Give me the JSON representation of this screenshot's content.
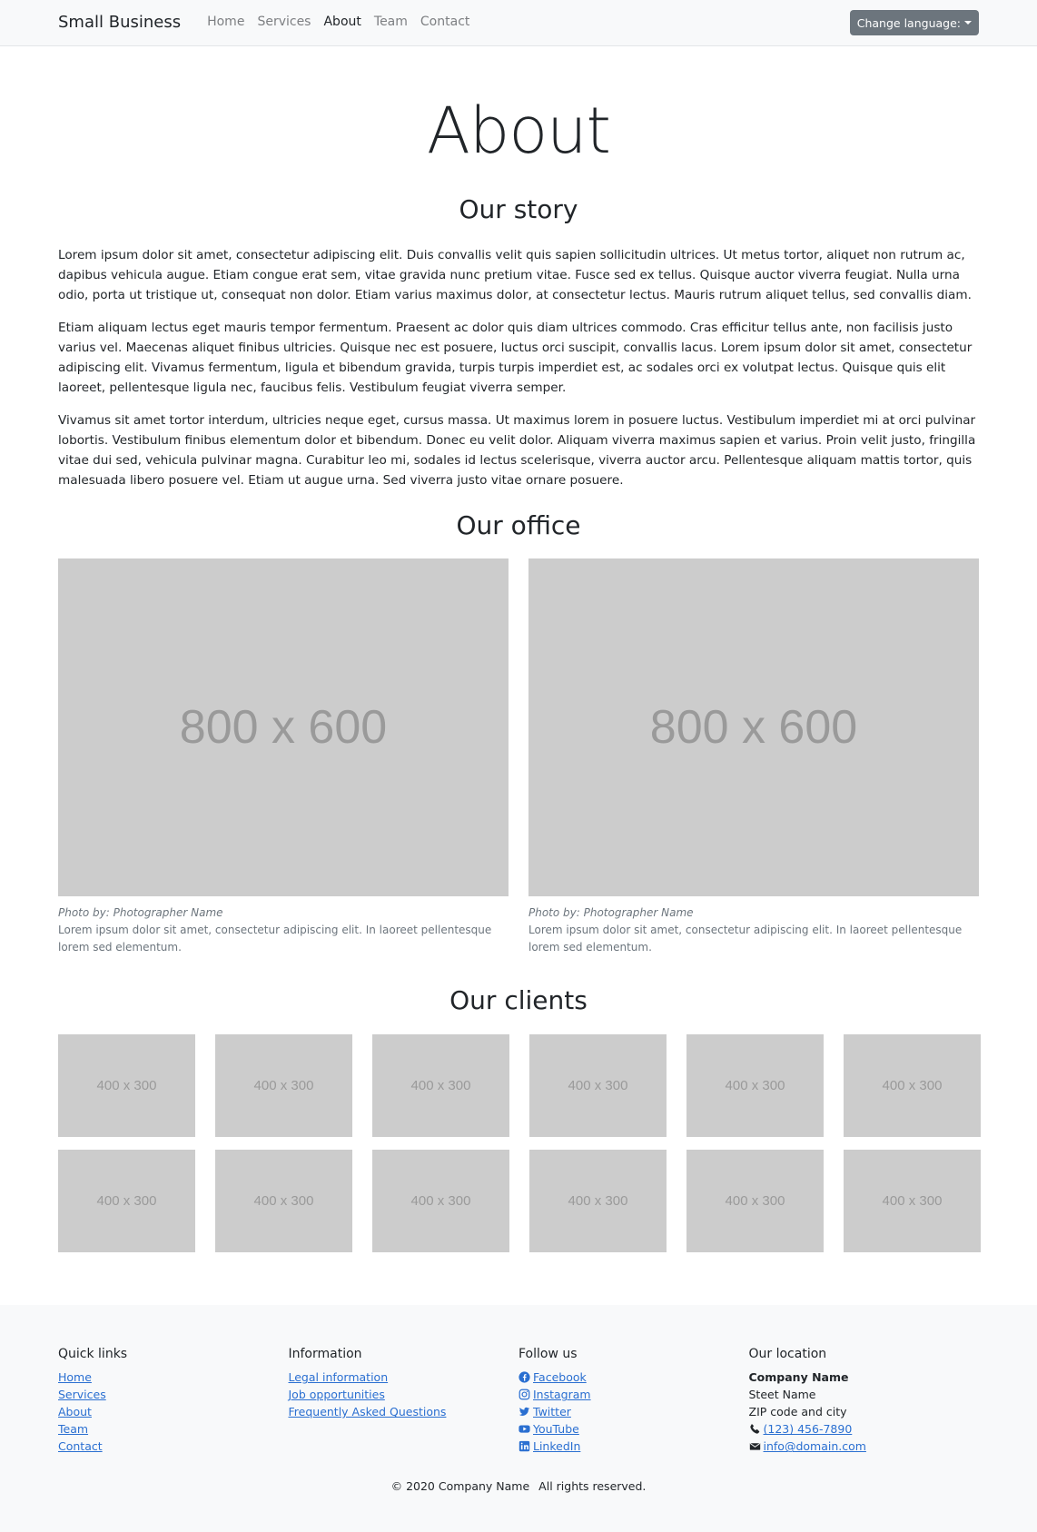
{
  "navbar": {
    "brand": "Small Business",
    "links": [
      "Home",
      "Services",
      "About",
      "Team",
      "Contact"
    ],
    "active": "About",
    "language_button": "Change language:"
  },
  "main": {
    "title": "About",
    "story": {
      "heading": "Our story",
      "paragraphs": [
        "Lorem ipsum dolor sit amet, consectetur adipiscing elit. Duis convallis velit quis sapien sollicitudin ultrices. Ut metus tortor, aliquet non rutrum ac, dapibus vehicula augue. Etiam congue erat sem, vitae gravida nunc pretium vitae. Fusce sed ex tellus. Quisque auctor viverra feugiat. Nulla urna odio, porta ut tristique ut, consequat non dolor. Etiam varius maximus dolor, at consectetur lectus. Mauris rutrum aliquet tellus, sed convallis diam.",
        "Etiam aliquam lectus eget mauris tempor fermentum. Praesent ac dolor quis diam ultrices commodo. Cras efficitur tellus ante, non facilisis justo varius vel. Maecenas aliquet finibus ultricies. Quisque nec est posuere, luctus orci suscipit, convallis lacus. Lorem ipsum dolor sit amet, consectetur adipiscing elit. Vivamus fermentum, ligula et bibendum gravida, turpis turpis imperdiet est, ac sodales orci ex volutpat lectus. Quisque quis elit laoreet, pellentesque ligula nec, faucibus felis. Vestibulum feugiat viverra semper.",
        "Vivamus sit amet tortor interdum, ultricies neque eget, cursus massa. Ut maximus lorem in posuere luctus. Vestibulum imperdiet mi at orci pulvinar lobortis. Vestibulum finibus elementum dolor et bibendum. Donec eu velit dolor. Aliquam viverra maximus sapien et varius. Proin velit justo, fringilla vitae dui sed, vehicula pulvinar magna. Curabitur leo mi, sodales id lectus scelerisque, viverra auctor arcu. Pellentesque aliquam mattis tortor, quis malesuada libero posuere vel. Etiam ut augue urna. Sed viverra justo vitae ornare posuere."
      ]
    },
    "office": {
      "heading": "Our office",
      "photos": [
        {
          "placeholder": "800 x 600",
          "credit": "Photo by: Photographer Name",
          "caption": "Lorem ipsum dolor sit amet, consectetur adipiscing elit. In laoreet pellentesque lorem sed elementum."
        },
        {
          "placeholder": "800 x 600",
          "credit": "Photo by: Photographer Name",
          "caption": "Lorem ipsum dolor sit amet, consectetur adipiscing elit. In laoreet pellentesque lorem sed elementum."
        }
      ]
    },
    "clients": {
      "heading": "Our clients",
      "logos": [
        "400 x 300",
        "400 x 300",
        "400 x 300",
        "400 x 300",
        "400 x 300",
        "400 x 300",
        "400 x 300",
        "400 x 300",
        "400 x 300",
        "400 x 300",
        "400 x 300",
        "400 x 300"
      ]
    }
  },
  "footer": {
    "quick_links": {
      "heading": "Quick links",
      "items": [
        "Home",
        "Services",
        "About",
        "Team",
        "Contact"
      ]
    },
    "information": {
      "heading": "Information",
      "items": [
        "Legal information",
        "Job opportunities",
        "Frequently Asked Questions"
      ]
    },
    "follow_us": {
      "heading": "Follow us",
      "items": [
        {
          "label": "Facebook",
          "icon": "facebook-icon"
        },
        {
          "label": "Instagram",
          "icon": "instagram-icon"
        },
        {
          "label": "Twitter",
          "icon": "twitter-icon"
        },
        {
          "label": "YouTube",
          "icon": "youtube-icon"
        },
        {
          "label": "LinkedIn",
          "icon": "linkedin-icon"
        }
      ]
    },
    "location": {
      "heading": "Our location",
      "company": "Company Name",
      "street": "Steet Name",
      "zip_city": "ZIP code and city",
      "phone": "(123) 456-7890",
      "email": "info@domain.com"
    },
    "copyright": "© 2020 Company Name",
    "rights": "All rights reserved.",
    "link_color": "#2a6fd1"
  }
}
